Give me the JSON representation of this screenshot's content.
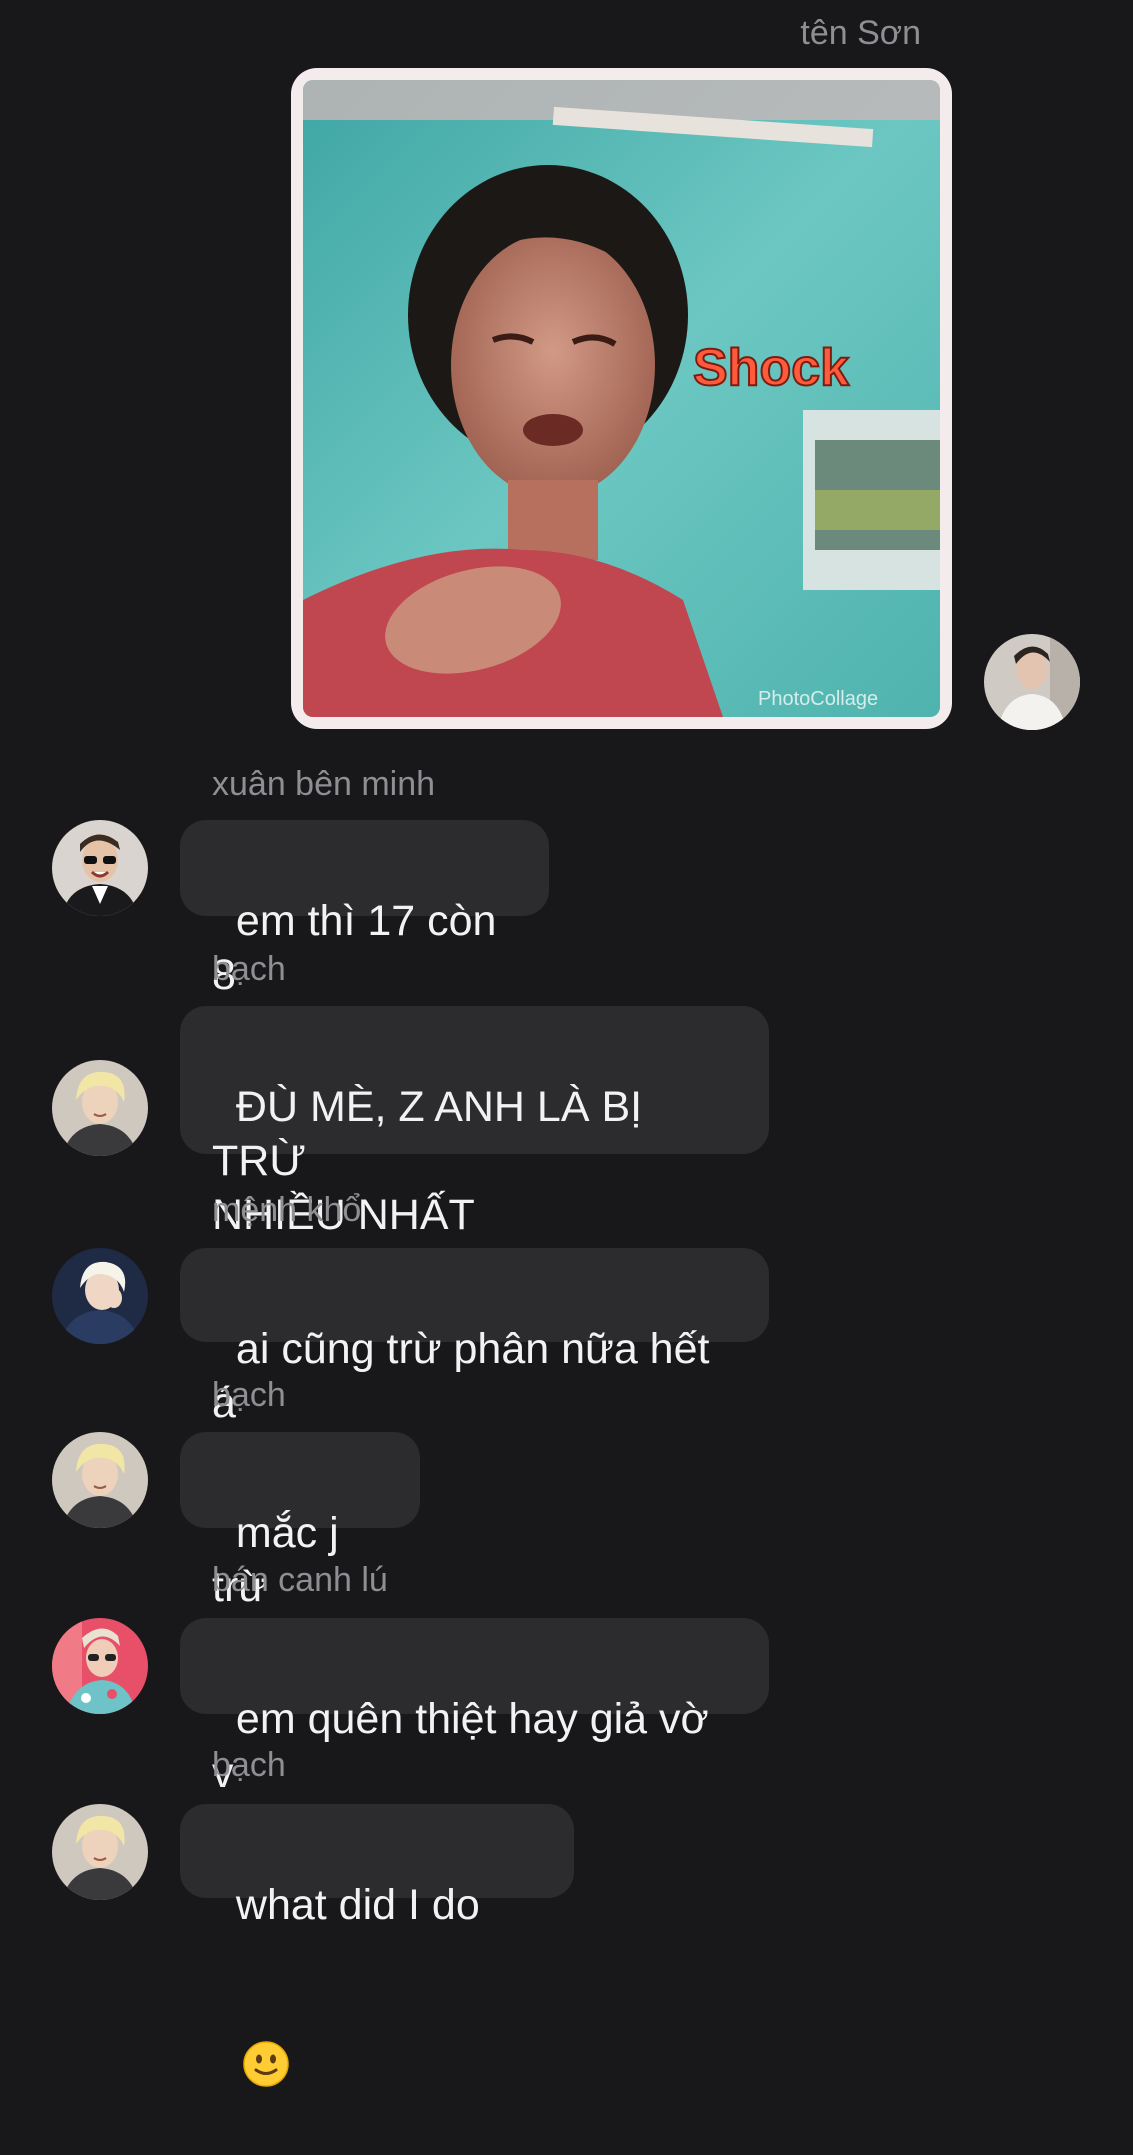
{
  "messages": [
    {
      "sender": "tên Sơn",
      "type": "image",
      "image_caption": "Shock",
      "watermark": "PhotoCollage"
    },
    {
      "sender": "xuân bên minh",
      "text": "em thì 17 còn 8"
    },
    {
      "sender": "bạch",
      "text": "ĐÙ MÈ, Z ANH LÀ BỊ TRỪ\nNHIỀU NHẤT"
    },
    {
      "sender": "mệnh khổ",
      "text": "ai cũng trừ phân nữa hết á"
    },
    {
      "sender": "bạch",
      "text": "mắc j trừ"
    },
    {
      "sender": "bán canh lú",
      "text": "em quên thiệt hay giả vờ v"
    },
    {
      "sender": "bạch",
      "text": "what did I do",
      "emoji": "slightly-smiling-face"
    }
  ],
  "colors": {
    "background": "#18181b",
    "bubble": "#2c2c2e",
    "name": "#8e8e93",
    "text": "#f2f2f2"
  }
}
